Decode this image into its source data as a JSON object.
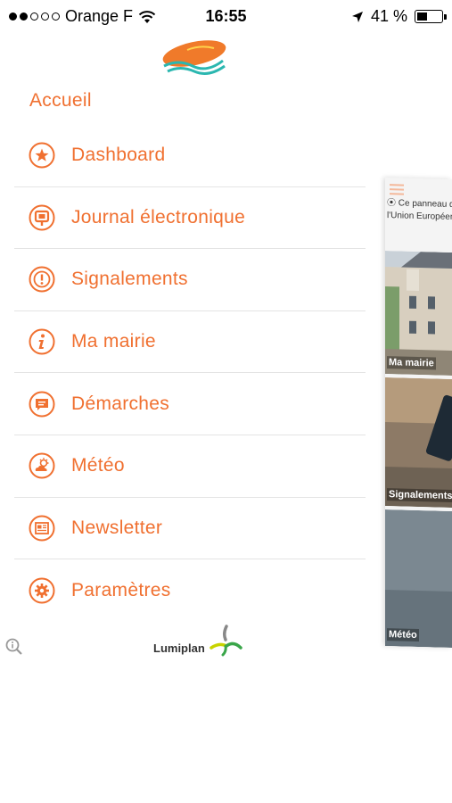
{
  "status_bar": {
    "carrier": "Orange F",
    "time": "16:55",
    "battery_text": "41 %",
    "battery_level": 0.41,
    "signal_bars_filled": 2,
    "signal_bars_total": 5
  },
  "menu": {
    "home_label": "Accueil",
    "items": [
      {
        "label": "Dashboard",
        "icon": "star-icon"
      },
      {
        "label": "Journal électronique",
        "icon": "sign-icon"
      },
      {
        "label": "Signalements",
        "icon": "alert-icon"
      },
      {
        "label": "Ma mairie",
        "icon": "info-icon"
      },
      {
        "label": "Démarches",
        "icon": "chat-icon"
      },
      {
        "label": "Météo",
        "icon": "weather-icon"
      },
      {
        "label": "Newsletter",
        "icon": "newsletter-icon"
      },
      {
        "label": "Paramètres",
        "icon": "gear-icon"
      }
    ]
  },
  "footer": {
    "brand": "Lumiplan"
  },
  "background_screen": {
    "news_line1": "Ce panneau d'i",
    "news_line2": "l'Union Européenne",
    "tiles": [
      {
        "label": "Ma mairie"
      },
      {
        "label": "Signalements"
      },
      {
        "label": "Météo"
      }
    ]
  },
  "colors": {
    "accent": "#f07030",
    "divider": "#e4e4e4"
  }
}
